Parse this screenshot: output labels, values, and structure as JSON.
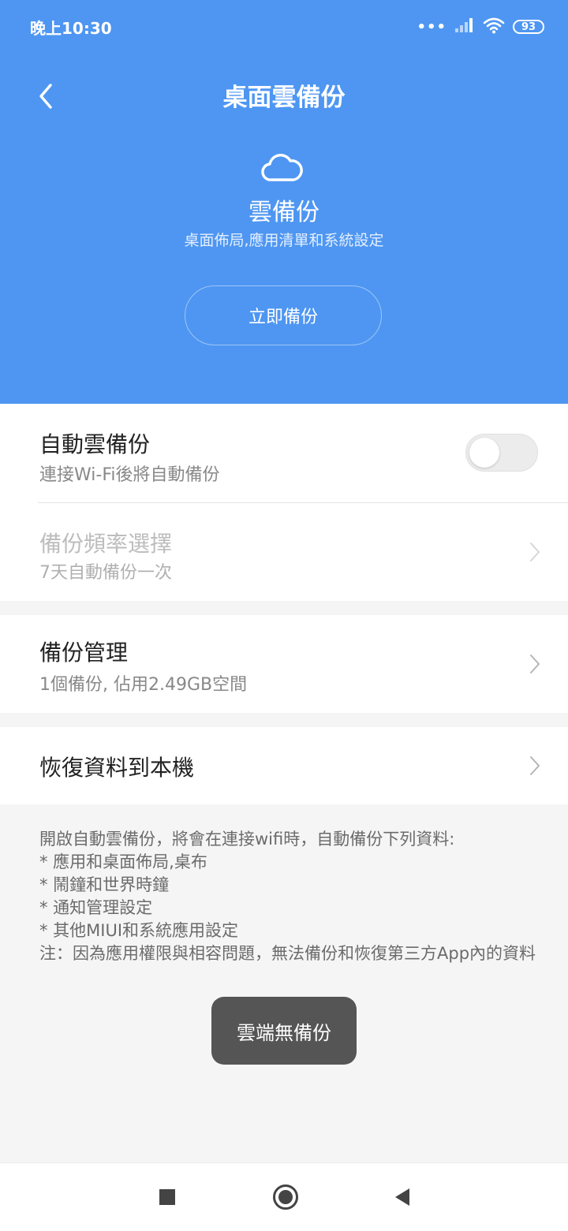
{
  "status_bar": {
    "time": "晚上10:30",
    "battery": "93",
    "signal_dots": "•••"
  },
  "header": {
    "title": "桌面雲備份",
    "hero_title": "雲備份",
    "hero_subtitle": "桌面佈局,應用清單和系統設定",
    "backup_now_label": "立即備份",
    "background_color": "#4e96f2"
  },
  "settings": {
    "auto_backup": {
      "title": "自動雲備份",
      "subtitle": "連接Wi-Fi後將自動備份",
      "enabled": false
    },
    "frequency": {
      "title": "備份頻率選擇",
      "subtitle": "7天自動備份一次"
    },
    "management": {
      "title": "備份管理",
      "subtitle": "1個備份, 佔用2.49GB空間"
    },
    "restore": {
      "title": "恢復資料到本機"
    }
  },
  "info_lines": [
    "開啟自動雲備份，將會在連接wifi時，自動備份下列資料:",
    "*  應用和桌面佈局,桌布",
    "*  鬧鐘和世界時鐘",
    "*  通知管理設定",
    "*  其他MIUI和系統應用設定",
    "注：因為應用權限與相容問題，無法備份和恢復第三方App內的資料"
  ],
  "toast": "雲端無備份"
}
